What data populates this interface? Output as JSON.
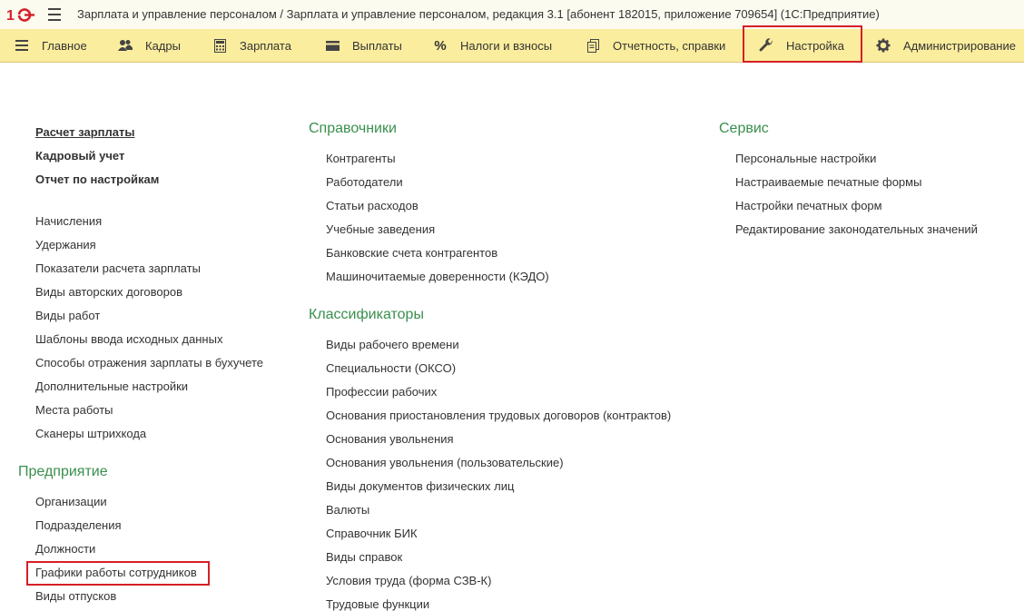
{
  "window": {
    "title": "Зарплата и управление персоналом / Зарплата и управление персоналом, редакция 3.1 [абонент 182015, приложение 709654]  (1С:Предприятие)"
  },
  "colors": {
    "section_bar": "#fbed9e",
    "group_title": "#3a8f4e",
    "highlight": "#d61f26"
  },
  "sections": [
    {
      "label": "Главное",
      "icon": "hamburger-icon"
    },
    {
      "label": "Кадры",
      "icon": "people-icon"
    },
    {
      "label": "Зарплата",
      "icon": "calculator-icon"
    },
    {
      "label": "Выплаты",
      "icon": "wallet-icon"
    },
    {
      "label": "Налоги и взносы",
      "icon": "percent-icon"
    },
    {
      "label": "Отчетность, справки",
      "icon": "documents-icon"
    },
    {
      "label": "Настройка",
      "icon": "wrench-icon",
      "active": true
    },
    {
      "label": "Администрирование",
      "icon": "gear-icon"
    }
  ],
  "col1": {
    "top": [
      "Расчет зарплаты",
      "Кадровый учет",
      "Отчет по настройкам"
    ],
    "items": [
      "Начисления",
      "Удержания",
      "Показатели расчета зарплаты",
      "Виды авторских договоров",
      "Виды работ",
      "Шаблоны ввода исходных данных",
      "Способы отражения зарплаты в бухучете",
      "Дополнительные настройки",
      "Места работы",
      "Сканеры штрихкода"
    ],
    "enterprise": {
      "title": "Предприятие",
      "items": [
        "Организации",
        "Подразделения",
        "Должности",
        "Графики работы сотрудников",
        "Виды отпусков"
      ]
    }
  },
  "col2": {
    "directories": {
      "title": "Справочники",
      "items": [
        "Контрагенты",
        "Работодатели",
        "Статьи расходов",
        "Учебные заведения",
        "Банковские счета контрагентов",
        "Машиночитаемые доверенности (КЭДО)"
      ]
    },
    "classifiers": {
      "title": "Классификаторы",
      "items": [
        "Виды рабочего времени",
        "Специальности (ОКСО)",
        "Профессии рабочих",
        "Основания приостановления трудовых договоров (контрактов)",
        "Основания увольнения",
        "Основания увольнения (пользовательские)",
        "Виды документов физических лиц",
        "Валюты",
        "Справочник БИК",
        "Виды справок",
        "Условия труда (форма СЗВ-К)",
        "Трудовые функции"
      ]
    }
  },
  "col3": {
    "service": {
      "title": "Сервис",
      "items": [
        "Персональные настройки",
        "Настраиваемые печатные формы",
        "Настройки печатных форм",
        "Редактирование законодательных значений"
      ]
    }
  }
}
